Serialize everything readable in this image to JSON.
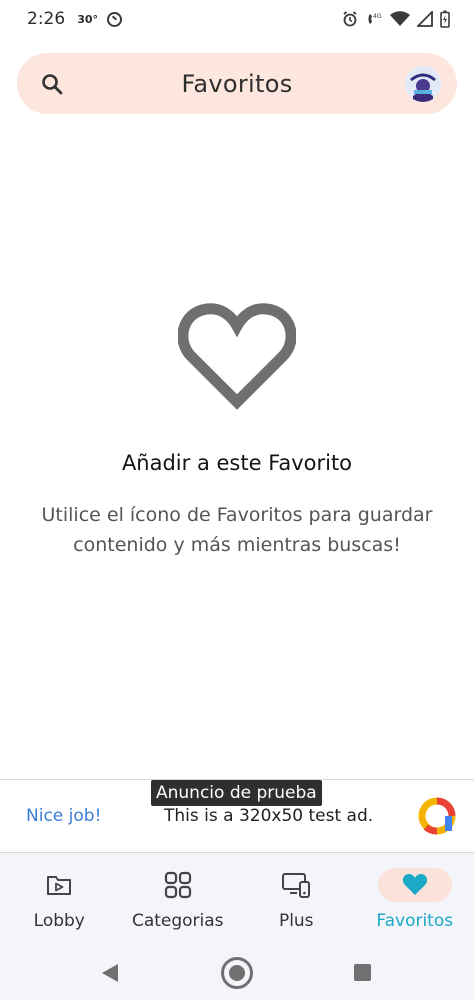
{
  "status_bar": {
    "time": "2:26",
    "temperature": "30°",
    "icons": [
      "alarm-icon",
      "volte-4g-icon",
      "wifi-icon",
      "signal-icon",
      "battery-icon"
    ]
  },
  "top_bar": {
    "title": "Favoritos",
    "search_icon": "search-icon",
    "avatar": "profile-avatar"
  },
  "empty_state": {
    "icon": "heart-outline-icon",
    "title": "Añadir a este Favorito",
    "description": "Utilice el ícono de Favoritos para guardar contenido y más mientras buscas!"
  },
  "ad": {
    "label": "Anuncio de prueba",
    "headline": "Nice job!",
    "body": "This is a 320x50 test ad."
  },
  "bottom_nav": {
    "items": [
      {
        "label": "Lobby",
        "icon": "folder-play-icon",
        "active": false
      },
      {
        "label": "Categorias",
        "icon": "grid-icon",
        "active": false
      },
      {
        "label": "Plus",
        "icon": "devices-icon",
        "active": false
      },
      {
        "label": "Favoritos",
        "icon": "heart-icon",
        "active": true
      }
    ]
  },
  "colors": {
    "top_bar_bg": "#fde6de",
    "active_nav": "#1aa9c6",
    "active_pill": "#fbe3dc",
    "heart_outline": "#6f6f6f",
    "ad_headline": "#3a7bd5"
  }
}
